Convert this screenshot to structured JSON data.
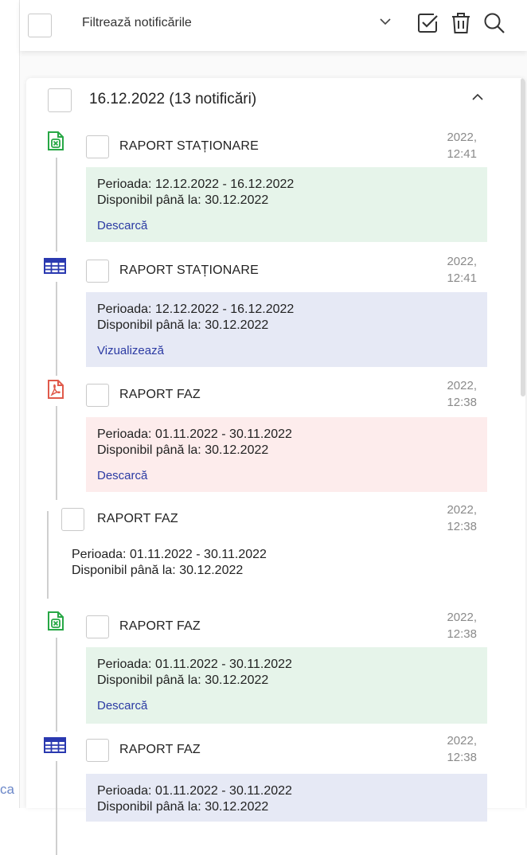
{
  "gutter_fragment": "ca",
  "header": {
    "filter_label": "Filtrează notificările"
  },
  "group": {
    "title": "16.12.2022 (13 notificări)"
  },
  "items": [
    {
      "type_icon": "excel-icon",
      "title": "RAPORT STAȚIONARE",
      "time_year": "2022,",
      "time_clock": "12:41",
      "period": "Perioada: 12.12.2022 - 16.12.2022",
      "available": "Disponibil până la: 30.12.2022",
      "action": "Descarcă",
      "tint": "green"
    },
    {
      "type_icon": "table-icon",
      "title": "RAPORT STAȚIONARE",
      "time_year": "2022,",
      "time_clock": "12:41",
      "period": "Perioada: 12.12.2022 - 16.12.2022",
      "available": "Disponibil până la: 30.12.2022",
      "action": "Vizualizează",
      "tint": "blue"
    },
    {
      "type_icon": "pdf-icon",
      "title": "RAPORT FAZ",
      "time_year": "2022,",
      "time_clock": "12:38",
      "period": "Perioada: 01.11.2022 - 30.11.2022",
      "available": "Disponibil până la: 30.12.2022",
      "action": "Descarcă",
      "tint": "red"
    },
    {
      "type_icon": "",
      "title": "RAPORT FAZ",
      "time_year": "2022,",
      "time_clock": "12:38",
      "period": "Perioada: 01.11.2022 - 30.11.2022",
      "available": "Disponibil până la: 30.12.2022",
      "action": "",
      "tint": "plain"
    },
    {
      "type_icon": "excel-icon",
      "title": "RAPORT FAZ",
      "time_year": "2022,",
      "time_clock": "12:38",
      "period": "Perioada: 01.11.2022 - 30.11.2022",
      "available": "Disponibil până la: 30.12.2022",
      "action": "Descarcă",
      "tint": "green"
    },
    {
      "type_icon": "table-icon",
      "title": "RAPORT FAZ",
      "time_year": "2022,",
      "time_clock": "12:38",
      "period": "Perioada: 01.11.2022 - 30.11.2022",
      "available": "Disponibil până la: 30.12.2022",
      "action": "",
      "tint": "blue"
    }
  ],
  "colors": {
    "excel": "#27a745",
    "table": "#2a39b0",
    "pdf": "#e05a4b",
    "link": "#2b3aa3"
  }
}
